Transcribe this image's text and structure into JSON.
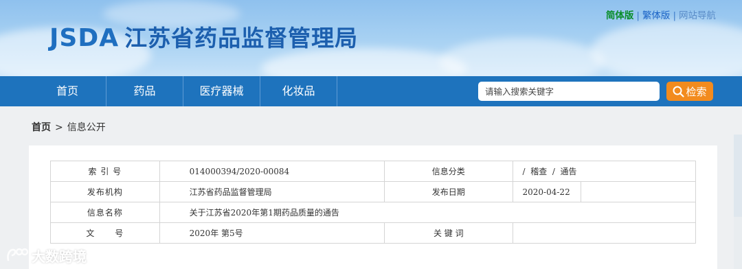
{
  "header": {
    "logo_mark": "JSDA",
    "org_name": "江苏省药品监督管理局",
    "links": {
      "simplified": "简体版",
      "separator1": "|",
      "traditional": "繁体版",
      "separator2": "|",
      "site_nav": "网站导航"
    }
  },
  "nav": {
    "items": [
      {
        "label": "首页"
      },
      {
        "label": "药品"
      },
      {
        "label": "医疗器械"
      },
      {
        "label": "化妆品"
      }
    ],
    "search_placeholder": "请输入搜索关键字",
    "search_button": "检索"
  },
  "breadcrumb": {
    "home": "首页",
    "separator": ">",
    "current": "信息公开"
  },
  "info_table": {
    "rows": [
      {
        "label": "索 引 号",
        "value": "014000394/2020-00084",
        "label2": "信息分类",
        "value2": "/  稽查  /  通告"
      },
      {
        "label": "发布机构",
        "value": "江苏省药品监督管理局",
        "label2": "发布日期",
        "value2": "2020-04-22"
      },
      {
        "label": "信息名称",
        "value": "关于江苏省2020年第1期药品质量的通告"
      },
      {
        "label": "文      号",
        "value": "2020年 第5号",
        "label2": "关 键 词",
        "value2": ""
      }
    ]
  },
  "watermark": {
    "text": "大数跨境"
  },
  "colors": {
    "nav_bg": "#1e73bd",
    "search_button": "#f28b1e",
    "logo_blue": "#1c5fae",
    "simplified_link": "#0a8d2a"
  }
}
